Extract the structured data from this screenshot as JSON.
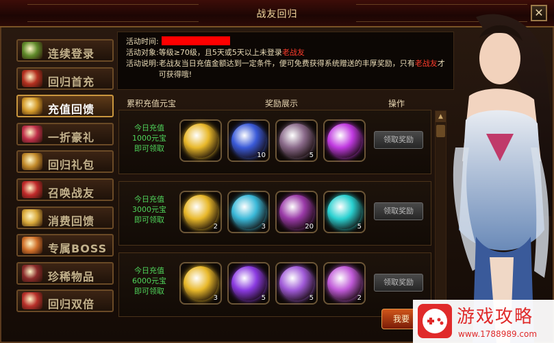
{
  "window": {
    "title": "战友回归",
    "close_label": "✕"
  },
  "sidebar": {
    "items": [
      {
        "label": "连续登录",
        "icon": "tree-icon",
        "color": "#5f8a2a",
        "active": false
      },
      {
        "label": "回归首充",
        "icon": "flower-gift-icon",
        "color": "#b43020",
        "active": false
      },
      {
        "label": "充值回馈",
        "icon": "money-bag-icon",
        "color": "#d49a2a",
        "active": true
      },
      {
        "label": "一折豪礼",
        "icon": "gift-boxes-icon",
        "color": "#c0304a",
        "active": false
      },
      {
        "label": "回归礼包",
        "icon": "treasure-chest-icon",
        "color": "#c28a2a",
        "active": false
      },
      {
        "label": "召唤战友",
        "icon": "flag-icon",
        "color": "#c02a2a",
        "active": false
      },
      {
        "label": "消费回馈",
        "icon": "coin-stack-icon",
        "color": "#d8a83a",
        "active": false
      },
      {
        "label": "专属BOSS",
        "icon": "boss-medal-icon",
        "color": "#d0702a",
        "active": false
      },
      {
        "label": "珍稀物品",
        "icon": "armor-icon",
        "color": "#8a2a2a",
        "active": false
      },
      {
        "label": "回归双倍",
        "icon": "scroll-icon",
        "color": "#b8302a",
        "active": false
      }
    ]
  },
  "info": {
    "time_label": "活动时间:",
    "target_label": "活动对象:",
    "target_text_a": "等级≥70级，且5天或5天以上未登录",
    "target_highlight": "老战友",
    "desc_label": "活动说明:",
    "desc_text_a": "老战友当日充值金额达到一定条件，便可免费获得系统赠送的丰厚奖励，只有",
    "desc_highlight": "老战友",
    "desc_text_b": "才可获得哦!"
  },
  "table": {
    "col_amount": "累积充值元宝",
    "col_rewards": "奖励展示",
    "col_action": "操作"
  },
  "rows": [
    {
      "req_line1": "今日充值",
      "req_line2": "1000元宝",
      "req_line3": "即可领取",
      "claim_label": "领取奖励",
      "items": [
        {
          "icon": "gold-orb-icon",
          "count": "",
          "color": "#e8b82a"
        },
        {
          "icon": "blue-orb-icon",
          "count": "10",
          "color": "#3a5ad8"
        },
        {
          "icon": "bone-scroll-icon",
          "count": "5",
          "color": "#8a6a8a"
        },
        {
          "icon": "purple-flame-orb-icon",
          "count": "",
          "color": "#c03ae0"
        }
      ]
    },
    {
      "req_line1": "今日充值",
      "req_line2": "3000元宝",
      "req_line3": "即可领取",
      "claim_label": "领取奖励",
      "items": [
        {
          "icon": "gold-orb-icon",
          "count": "2",
          "color": "#e8b82a"
        },
        {
          "icon": "cyan-orb-icon",
          "count": "3",
          "color": "#3ab8d8"
        },
        {
          "icon": "purple-seal-icon",
          "count": "20",
          "color": "#9a3aa8"
        },
        {
          "icon": "cyan-scroll-icon",
          "count": "5",
          "color": "#2ad0d0"
        }
      ]
    },
    {
      "req_line1": "今日充值",
      "req_line2": "6000元宝",
      "req_line3": "即可领取",
      "claim_label": "领取奖励",
      "items": [
        {
          "icon": "gold-orb-icon",
          "count": "3",
          "color": "#e8b82a"
        },
        {
          "icon": "purple-gem-icon",
          "count": "5",
          "color": "#8a3ae0"
        },
        {
          "icon": "telescope-icon",
          "count": "5",
          "color": "#a05ad8"
        },
        {
          "icon": "purple-chest-icon",
          "count": "2",
          "color": "#c05ad8"
        }
      ]
    }
  ],
  "share_button": "我要",
  "watermark": {
    "text": "游戏攻略",
    "url": "www.1788989.com"
  },
  "colors": {
    "highlight_red": "#ff3c2c",
    "req_green": "#4fd35a",
    "gold_border": "#c9963e"
  }
}
